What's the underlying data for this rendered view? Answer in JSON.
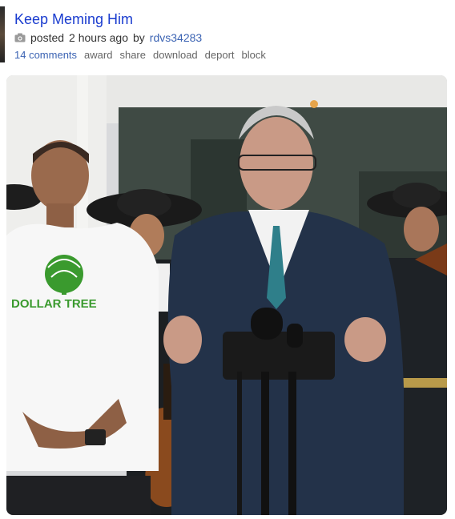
{
  "post": {
    "title": "Keep Meming Him",
    "posted_prefix": "posted",
    "posted_time": "2 hours ago",
    "by_word": "by",
    "author": "rdvs34283",
    "comments": "14 comments",
    "actions": [
      "award",
      "share",
      "download",
      "deport",
      "block"
    ]
  },
  "image": {
    "shirt_text": "DOLLAR TREE"
  },
  "colors": {
    "title": "#1a3ccf",
    "link": "#3b63b3",
    "action_gray": "#666666",
    "shirt_green": "#3a9a2e"
  }
}
